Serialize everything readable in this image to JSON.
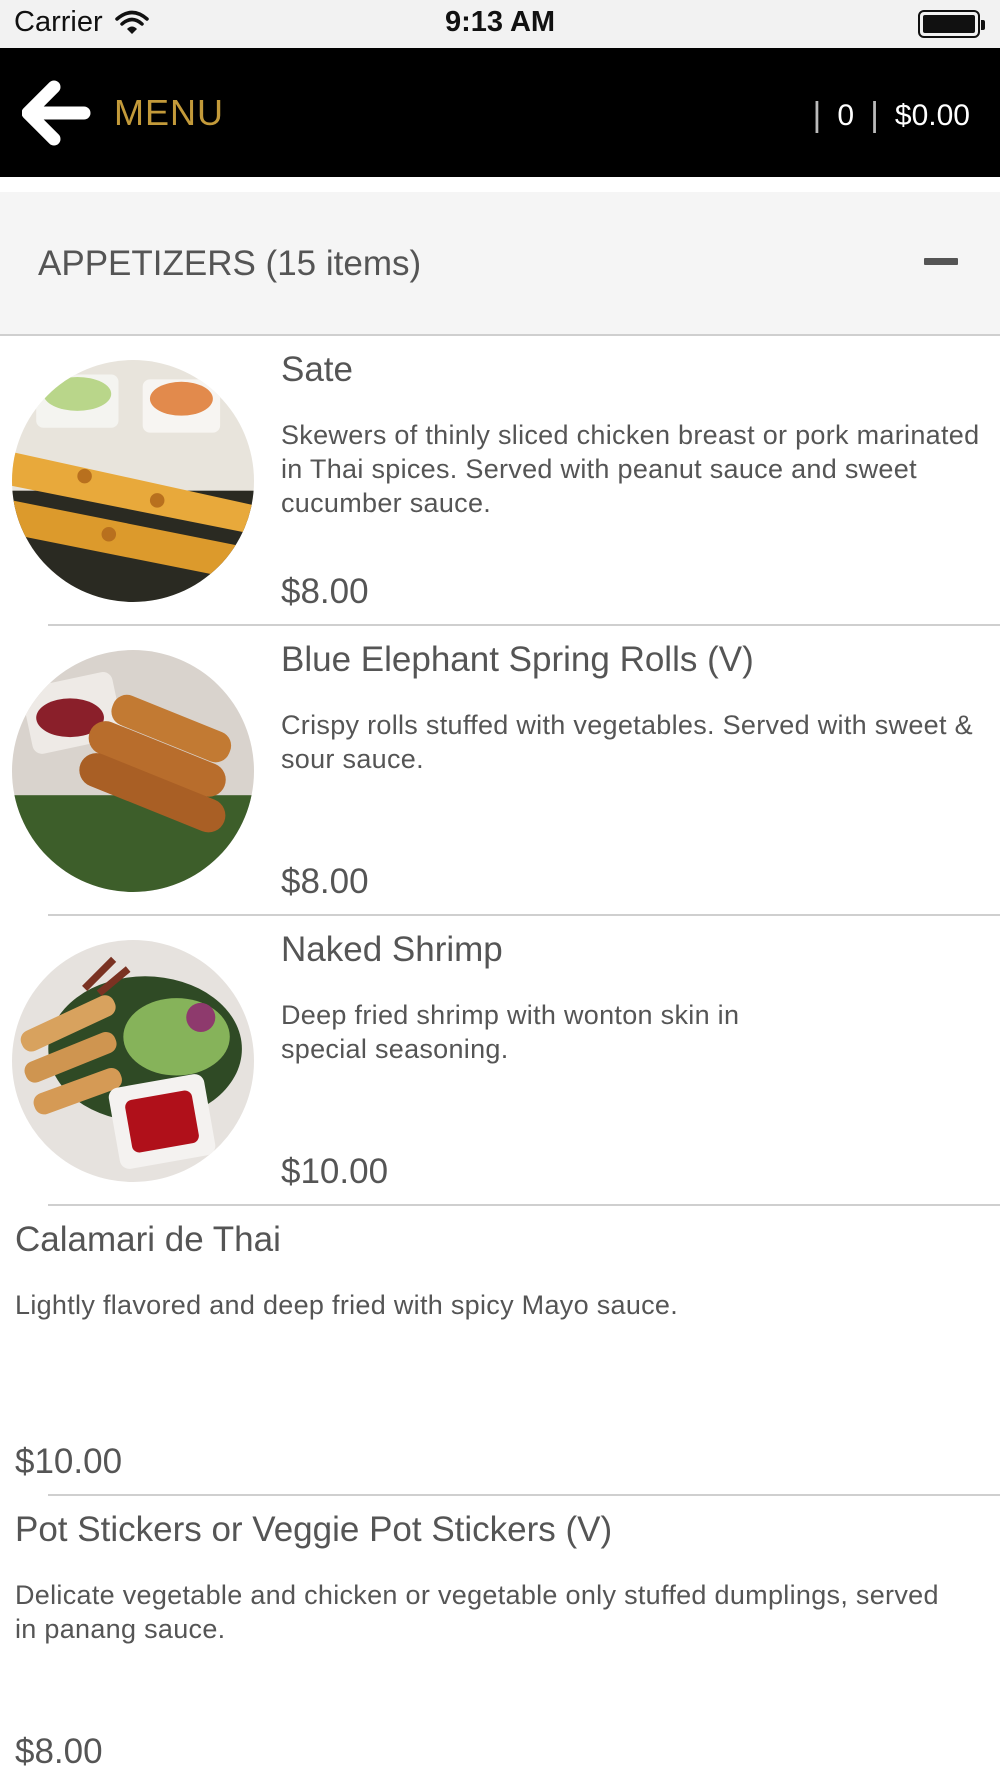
{
  "status_bar": {
    "carrier": "Carrier",
    "time": "9:13 AM"
  },
  "header": {
    "title": "MENU",
    "cart_count": "0",
    "cart_total": "$0.00",
    "separator": "|"
  },
  "category": {
    "title": "APPETIZERS (15 items)"
  },
  "items": [
    {
      "name": "Sate",
      "description": "Skewers of thinly sliced chicken breast or pork marinated in Thai spices. Served with peanut sauce and sweet cucumber sauce.",
      "price": "$8.00"
    },
    {
      "name": "Blue Elephant Spring Rolls (V)",
      "description": "Crispy rolls stuffed with vegetables. Served with sweet & sour sauce.",
      "price": "$8.00"
    },
    {
      "name": "Naked Shrimp",
      "description": "Deep fried shrimp with wonton skin in special seasoning.",
      "price": "$10.00"
    },
    {
      "name": "Calamari de Thai",
      "description": "Lightly flavored and deep fried with spicy Mayo sauce.",
      "price": "$10.00"
    },
    {
      "name": "Pot Stickers or Veggie Pot Stickers (V)",
      "description": "Delicate vegetable and chicken or vegetable only stuffed dumplings, served in panang sauce.",
      "price": "$8.00"
    }
  ],
  "icons": {
    "back": "arrow-left-icon",
    "collapse": "minus-icon",
    "wifi": "wifi-icon",
    "battery": "battery-icon"
  },
  "colors": {
    "header_bg": "#000000",
    "accent": "#c39a3a",
    "category_bg": "#f5f5f5"
  }
}
